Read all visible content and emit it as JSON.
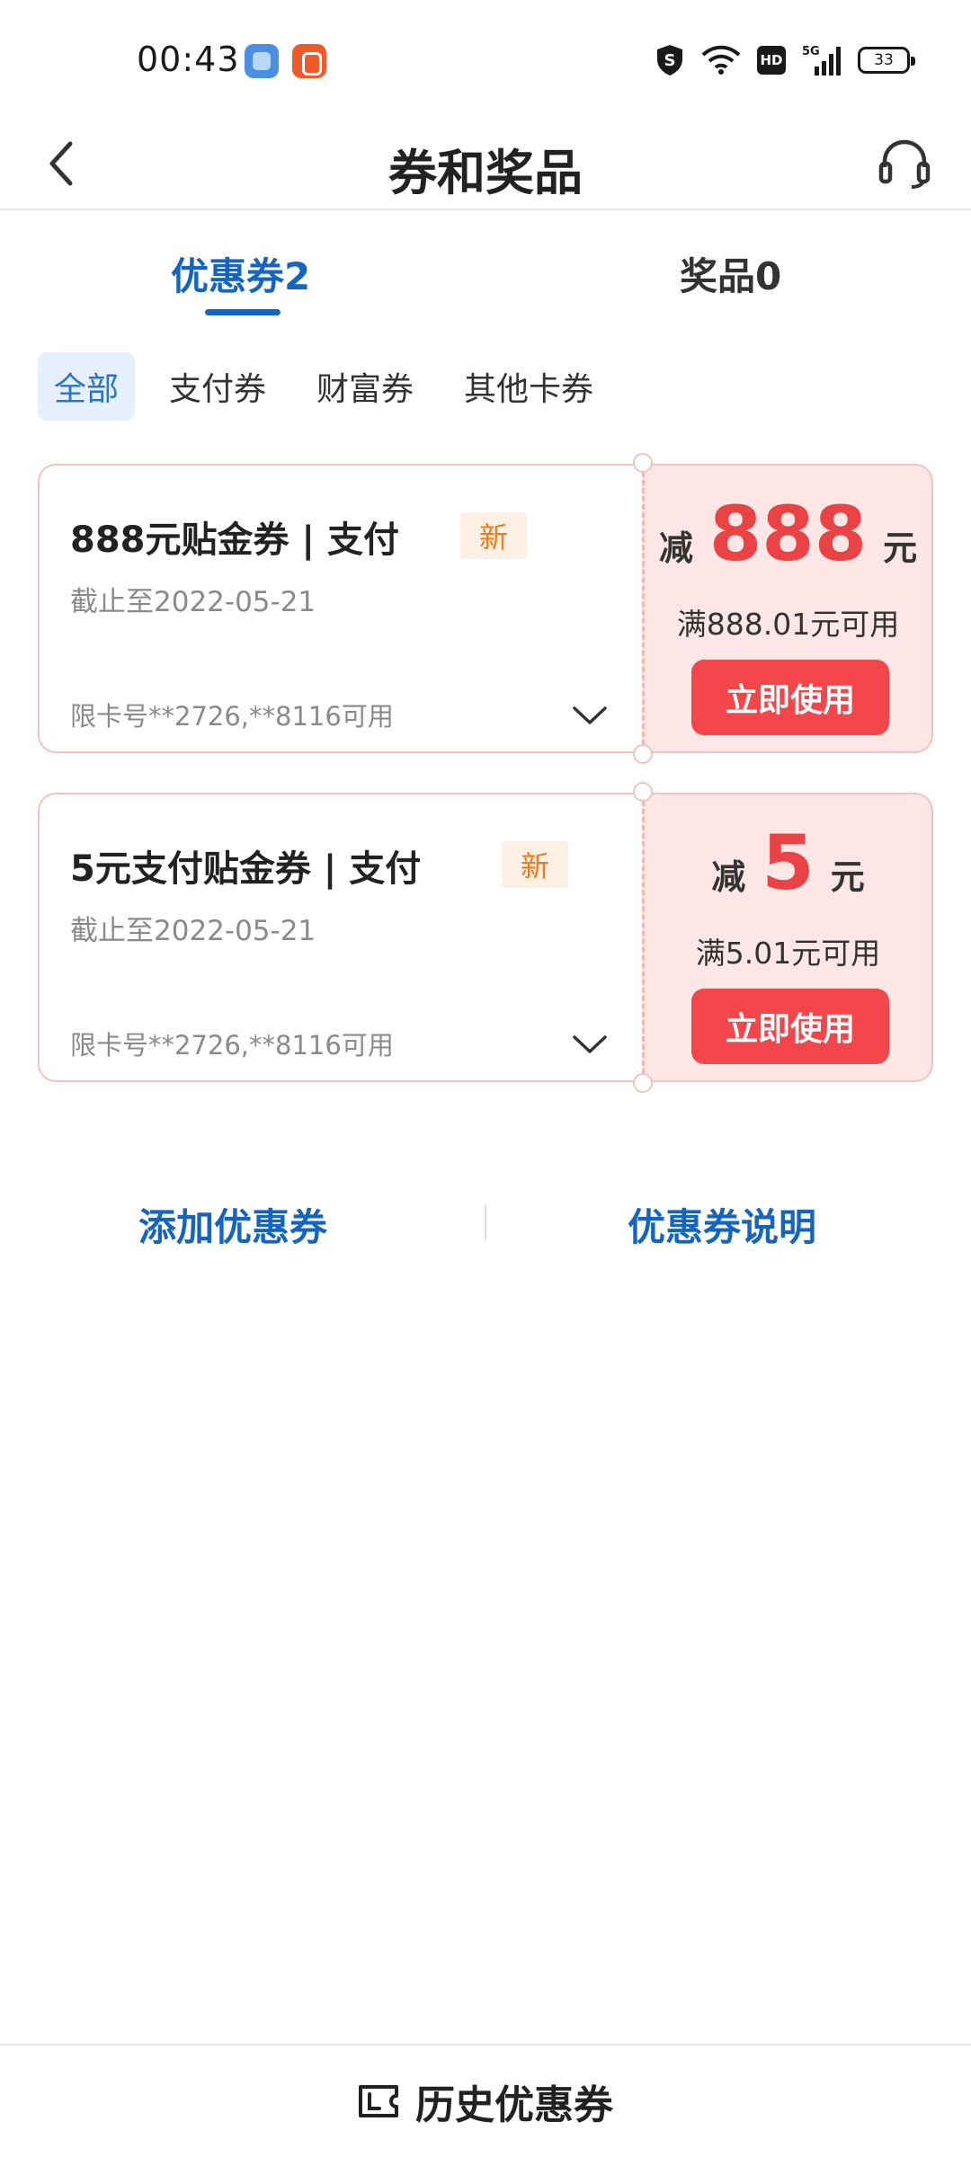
{
  "status_bar": {
    "time": "00:43",
    "network": "5G",
    "hd": "HD",
    "battery": "33"
  },
  "nav": {
    "title": "券和奖品"
  },
  "main_tabs": [
    {
      "label": "优惠券2",
      "active": true
    },
    {
      "label": "奖品0",
      "active": false
    }
  ],
  "filters": [
    {
      "label": "全部",
      "active": true
    },
    {
      "label": "支付券",
      "active": false
    },
    {
      "label": "财富券",
      "active": false
    },
    {
      "label": "其他卡券",
      "active": false
    }
  ],
  "coupons": [
    {
      "title": "888元贴金券 | 支付",
      "badge": "新",
      "expiry": "截止至2022-05-21",
      "card_limit": "限卡号**2726,**8116可用",
      "deduct_label": "减",
      "amount": "888",
      "unit": "元",
      "threshold": "满888.01元可用",
      "action": "立即使用"
    },
    {
      "title": "5元支付贴金券 | 支付",
      "badge": "新",
      "expiry": "截止至2022-05-21",
      "card_limit": "限卡号**2726,**8116可用",
      "deduct_label": "减",
      "amount": "5",
      "unit": "元",
      "threshold": "满5.01元可用",
      "action": "立即使用"
    }
  ],
  "links": {
    "add": "添加优惠券",
    "description": "优惠券说明"
  },
  "footer": {
    "history": "历史优惠券"
  },
  "colors": {
    "primary_blue": "#1565c0",
    "accent_red": "#e94345",
    "button_red": "#f2464a",
    "badge_orange": "#ef7a1a",
    "coupon_pink": "#fde7e6"
  }
}
